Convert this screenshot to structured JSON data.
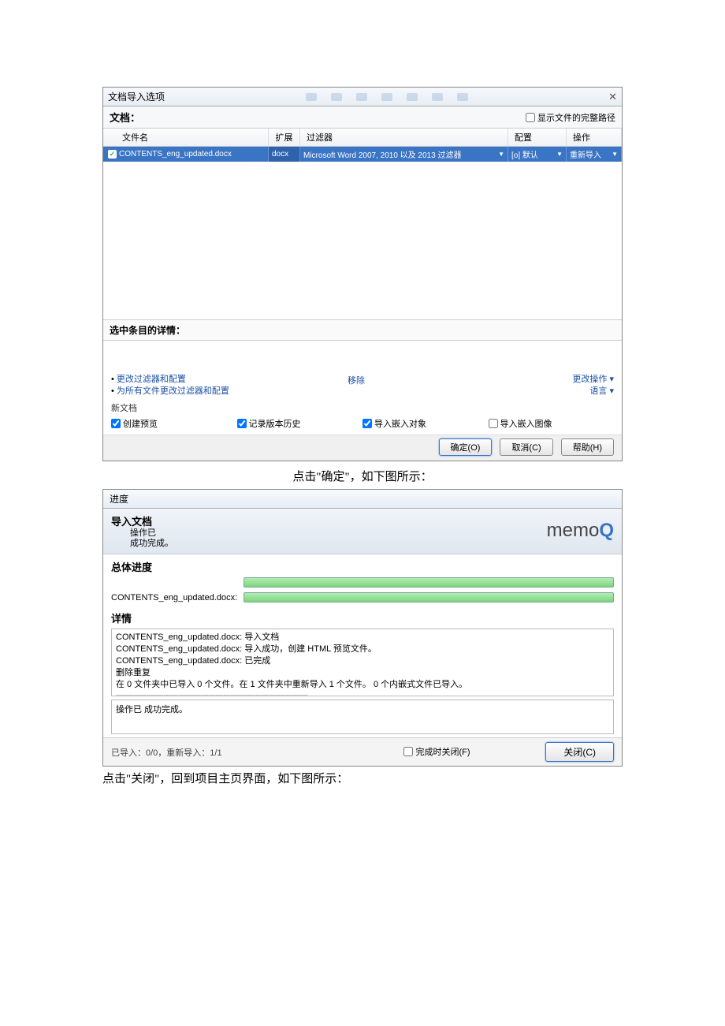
{
  "dialog1": {
    "title": "文档导入选项",
    "close": "✕",
    "doc_label": "文档：",
    "show_full_path": "显示文件的完整路径",
    "columns": {
      "name": "文件名",
      "ext": "扩展",
      "filter": "过滤器",
      "config": "配置",
      "action": "操作"
    },
    "row": {
      "name": "CONTENTS_eng_updated.docx",
      "ext": "docx",
      "filter": "Microsoft Word 2007, 2010 以及 2013 过滤器",
      "config": "[o] 默认",
      "action": "重新导入"
    },
    "details_label": "选中条目的详情：",
    "link_change": "更改过滤器和配置",
    "link_change_all": "为所有文件更改过滤器和配置",
    "link_remove": "移除",
    "link_change_op": "更改操作 ▾",
    "link_lang": "语言 ▾",
    "newdoc": "新文档",
    "cb_preview": "创建预览",
    "cb_history": "记录版本历史",
    "cb_embed_obj": "导入嵌入对象",
    "cb_embed_img": "导入嵌入图像",
    "btn_ok": "确定(O)",
    "btn_cancel": "取消(C)",
    "btn_help": "帮助(H)"
  },
  "caption1": "点击\"确定\"，如下图所示：",
  "dialog2": {
    "title": "进度",
    "header_title": "导入文档",
    "header_sub1": "操作已",
    "header_sub2": "成功完成。",
    "logo": "memo",
    "overall": "总体进度",
    "file_label": "CONTENTS_eng_updated.docx:",
    "details_title": "详情",
    "line1": "CONTENTS_eng_updated.docx: 导入文档",
    "line2": "CONTENTS_eng_updated.docx: 导入成功，创建 HTML 预览文件。",
    "line3": "CONTENTS_eng_updated.docx: 已完成",
    "line4": "删除重复",
    "line5": "在 0 文件夹中已导入 0 个文件。在 1 文件夹中重新导入 1 个文件。 0 个内嵌式文件已导入。",
    "dashes": "-----------------------------------------------------------------------------",
    "complete": "操作已 成功完成。",
    "footer_left": "已导入：0/0，重新导入：1/1",
    "footer_cb": "完成时关闭(F)",
    "btn_close": "关闭(C)"
  },
  "body_text": "点击\"关闭\"，回到项目主页界面，如下图所示："
}
